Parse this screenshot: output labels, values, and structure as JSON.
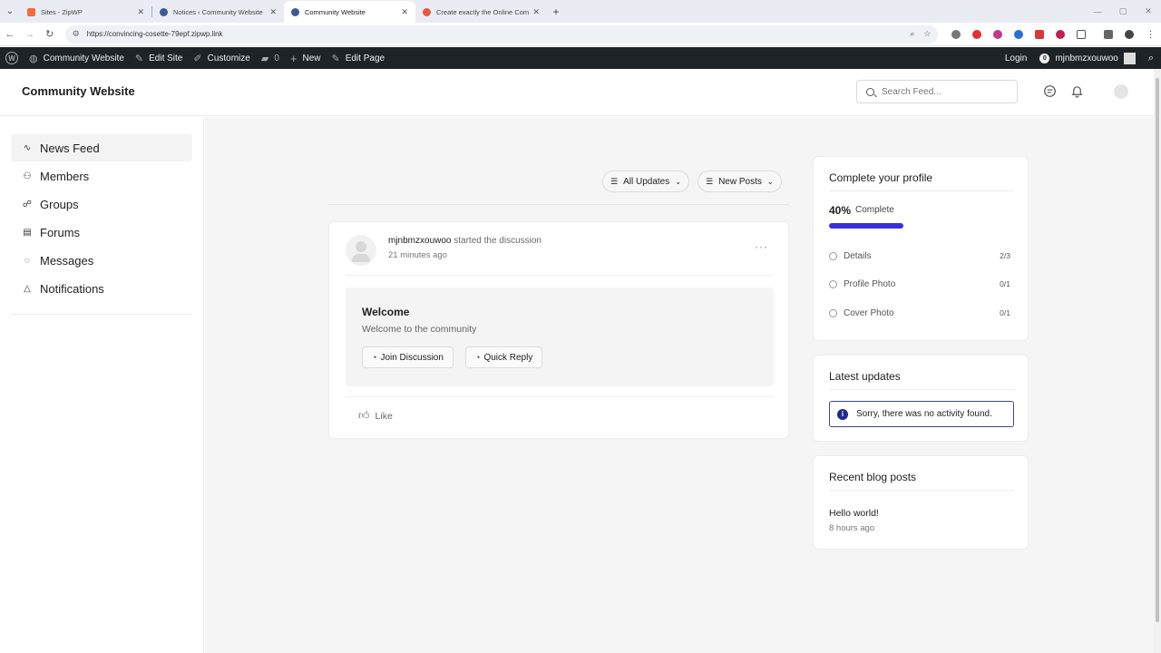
{
  "browser": {
    "tabs": [
      {
        "title": "Sites - ZipWP",
        "favicon_color": "#f26b3a",
        "active": false
      },
      {
        "title": "Notices ‹ Community Website",
        "favicon_color": "#3c5a99",
        "active": false
      },
      {
        "title": "Community Website",
        "favicon_color": "#3c5a99",
        "active": true
      },
      {
        "title": "Create exactly the Online Comm",
        "favicon_color": "#e55a3c",
        "active": false
      }
    ],
    "url": "https://convincing-cosette-79epf.zipwp.link"
  },
  "adminbar": {
    "site_name": "Community Website",
    "edit_site": "Edit Site",
    "customize": "Customize",
    "comments_count": "0",
    "new": "New",
    "edit_page": "Edit Page",
    "login": "Login",
    "notif_count": "0",
    "username": "mjnbmzxouwoo"
  },
  "header": {
    "site_title": "Community Website",
    "search_placeholder": "Search Feed..."
  },
  "sidebar": {
    "items": [
      {
        "label": "News Feed",
        "icon": "activity-icon",
        "active": true
      },
      {
        "label": "Members",
        "icon": "members-icon"
      },
      {
        "label": "Groups",
        "icon": "groups-icon"
      },
      {
        "label": "Forums",
        "icon": "forums-icon"
      },
      {
        "label": "Messages",
        "icon": "messages-icon"
      },
      {
        "label": "Notifications",
        "icon": "bell-icon"
      }
    ]
  },
  "feed": {
    "filter_all": "All Updates",
    "filter_new": "New Posts",
    "post": {
      "author": "mjnbmzxouwoo",
      "action": "started the discussion",
      "time": "21 minutes ago",
      "title": "Welcome",
      "body": "Welcome to the community",
      "join_label": "Join Discussion",
      "reply_label": "Quick Reply",
      "like_label": "Like"
    }
  },
  "profile": {
    "title": "Complete your profile",
    "percent": "40%",
    "percent_label": "Complete",
    "progress": 0.4,
    "accent_color": "#3b2fd8",
    "items": [
      {
        "label": "Details",
        "count": "2/3"
      },
      {
        "label": "Profile Photo",
        "count": "0/1"
      },
      {
        "label": "Cover Photo",
        "count": "0/1"
      }
    ]
  },
  "latest": {
    "title": "Latest updates",
    "notice": "Sorry, there was no activity found."
  },
  "blog": {
    "title": "Recent blog posts",
    "post_title": "Hello world!",
    "post_time": "8 hours ago"
  }
}
